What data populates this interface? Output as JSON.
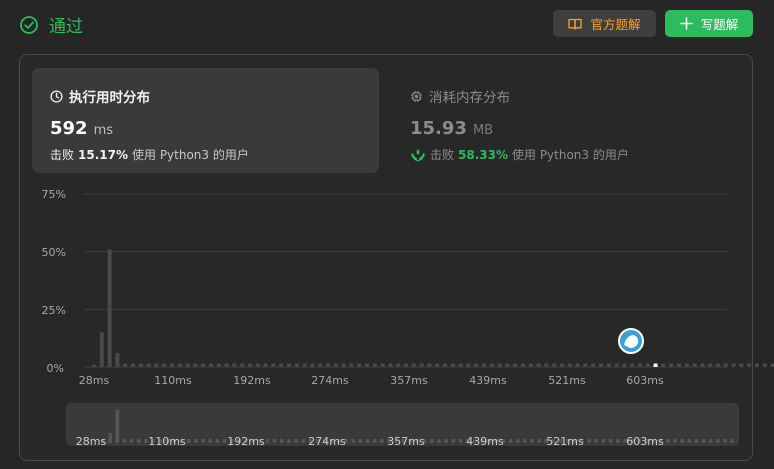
{
  "status": {
    "text": "通过",
    "color": "#2cbb5d"
  },
  "buttons": {
    "official_solution": "官方题解",
    "write_solution": "写题解"
  },
  "runtime": {
    "title": "执行用时分布",
    "value": "592",
    "unit": "ms",
    "beats_label": "击败",
    "beats_percent": "15.17%",
    "beats_rest": "使用 Python3 的用户"
  },
  "memory": {
    "title": "消耗内存分布",
    "value": "15.93",
    "unit": "MB",
    "beats_label": "击败",
    "beats_percent": "58.33%",
    "beats_rest": "使用 Python3 的用户"
  },
  "chart_data": {
    "type": "bar",
    "title": "",
    "xlabel": "",
    "ylabel": "",
    "y_tick_labels": [
      "75%",
      "50%",
      "25%",
      "0%"
    ],
    "yticks": [
      75,
      50,
      25,
      0
    ],
    "ylim": [
      0,
      75
    ],
    "x_tick_labels": [
      "28ms",
      "110ms",
      "192ms",
      "274ms",
      "357ms",
      "439ms",
      "521ms",
      "603ms"
    ],
    "xlim": [
      18,
      738
    ],
    "bin_width": 8,
    "grid": true,
    "values": [
      1.0,
      15.0,
      51.0,
      6.0,
      1.5,
      1.5,
      1.5,
      1.5,
      1.5,
      1.5,
      1.5,
      1.5,
      1.5,
      1.5,
      1.5,
      1.5,
      1.5,
      1.5,
      1.5,
      1.5,
      1.5,
      1.5,
      1.5,
      1.5,
      1.5,
      1.5,
      1.5,
      1.5,
      1.5,
      1.5,
      1.5,
      1.5,
      1.5,
      1.5,
      1.5,
      1.5,
      1.5,
      1.5,
      1.5,
      1.5,
      1.5,
      1.5,
      1.5,
      1.5,
      1.5,
      1.5,
      1.5,
      1.5,
      1.5,
      1.5,
      1.5,
      1.5,
      1.5,
      1.5,
      1.5,
      1.5,
      1.5,
      1.5,
      1.5,
      1.5,
      1.5,
      1.5,
      1.5,
      1.5,
      1.5,
      1.5,
      1.5,
      1.5,
      1.5,
      1.5,
      1.5,
      1.5,
      1.5,
      1.5,
      1.5,
      1.5,
      1.5,
      1.5,
      1.5,
      1.5,
      1.5,
      1.5,
      1.5,
      1.5,
      1.5,
      1.5,
      1.5,
      1.5,
      1.5
    ],
    "highlight_index": 72,
    "overview_tick_labels": [
      "28ms",
      "110ms",
      "192ms",
      "274ms",
      "357ms",
      "439ms",
      "521ms",
      "603ms"
    ]
  },
  "colors": {
    "bar": "#4a4a4a",
    "bar_highlight": "#ffffff",
    "grid": "#3e3e3e",
    "accent": "#2cbb5d",
    "brand": "#ffa116"
  }
}
